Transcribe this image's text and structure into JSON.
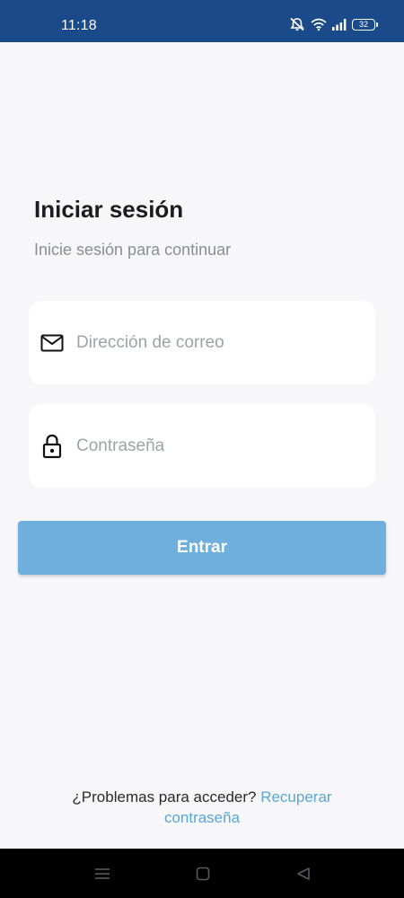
{
  "status_bar": {
    "time": "11:18",
    "battery": "32",
    "icons": [
      "mute-icon",
      "wifi-icon",
      "signal-icon",
      "battery-icon"
    ]
  },
  "login": {
    "title": "Iniciar sesión",
    "subtitle": "Inicie sesión para continuar",
    "email_placeholder": "Dirección de correo",
    "email_value": "",
    "password_placeholder": "Contraseña",
    "password_value": "",
    "submit_label": "Entrar"
  },
  "footer": {
    "question": "¿Problemas para acceder?",
    "recover_link": "Recuperar contraseña"
  },
  "nav_bar": {
    "icons": [
      "menu-icon",
      "home-icon",
      "back-icon"
    ]
  },
  "colors": {
    "status_bar": "#1b4a8a",
    "background": "#f7f7f9",
    "button": "#6fafdd",
    "link": "#5aa6d8",
    "placeholder": "#9ea3a8"
  }
}
